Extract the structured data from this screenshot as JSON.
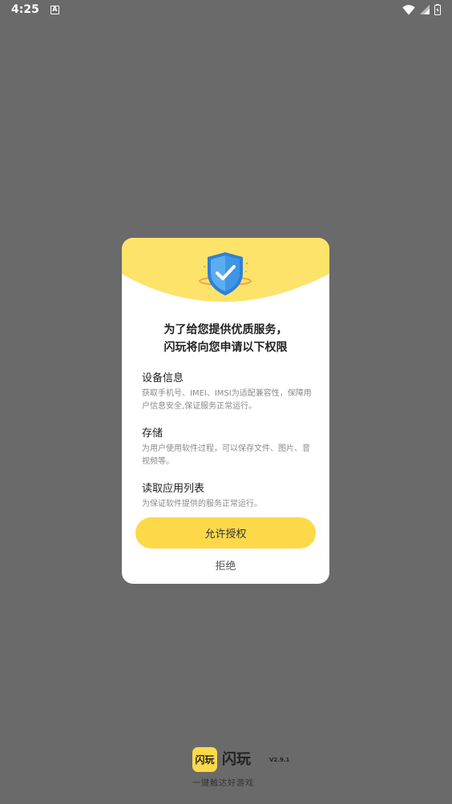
{
  "status_bar": {
    "time": "4:25",
    "app_icon": "A",
    "icons": [
      "wifi-icon",
      "signal-icon",
      "battery-icon"
    ]
  },
  "dialog": {
    "title_line1": "为了给您提供优质服务，",
    "title_line2": "闪玩将向您申请以下权限",
    "permissions": [
      {
        "title": "设备信息",
        "desc": "获取手机号、IMEI、IMSI为适配兼容性，保障用户信息安全,保证服务正常运行。"
      },
      {
        "title": "存储",
        "desc": "为用户使用软件过程，可以保存文件、图片、音视频等。"
      },
      {
        "title": "读取应用列表",
        "desc": "为保证软件提供的服务正常运行。"
      }
    ],
    "allow_label": "允许授权",
    "deny_label": "拒绝"
  },
  "brand": {
    "logo_text": "闪玩",
    "name": "闪玩",
    "version": "V2.9.1",
    "slogan": "一键触达好游戏"
  },
  "colors": {
    "accent": "#fdd94a",
    "overlay": "#6a6a6a",
    "shield_blue": "#3b8fe0"
  }
}
